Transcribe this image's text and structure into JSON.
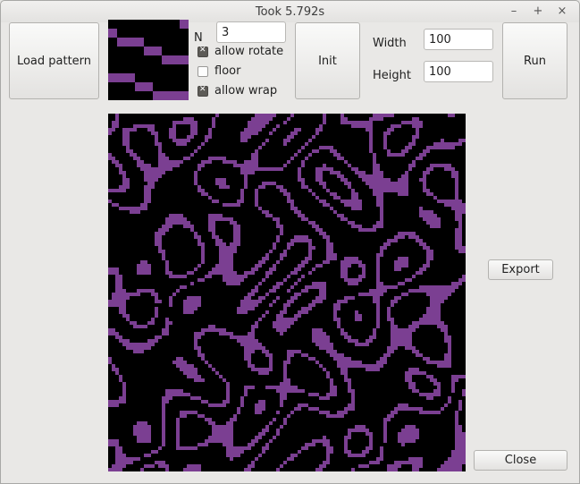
{
  "window": {
    "title": "Took 5.792s",
    "minimize_glyph": "–",
    "maximize_glyph": "+",
    "close_glyph": "×"
  },
  "controls": {
    "load_pattern_label": "Load pattern",
    "n_label": "N",
    "n_value": "3",
    "allow_rotate": {
      "label": "allow rotate",
      "checked": true
    },
    "floor": {
      "label": "floor",
      "checked": false
    },
    "allow_wrap": {
      "label": "allow wrap",
      "checked": true
    },
    "init_label": "Init",
    "width_label": "Width",
    "width_value": "100",
    "height_label": "Height",
    "height_value": "100",
    "run_label": "Run",
    "export_label": "Export",
    "close_label": "Close"
  },
  "colors": {
    "pattern_on": "#7b3f92",
    "pattern_off": "#000000"
  }
}
